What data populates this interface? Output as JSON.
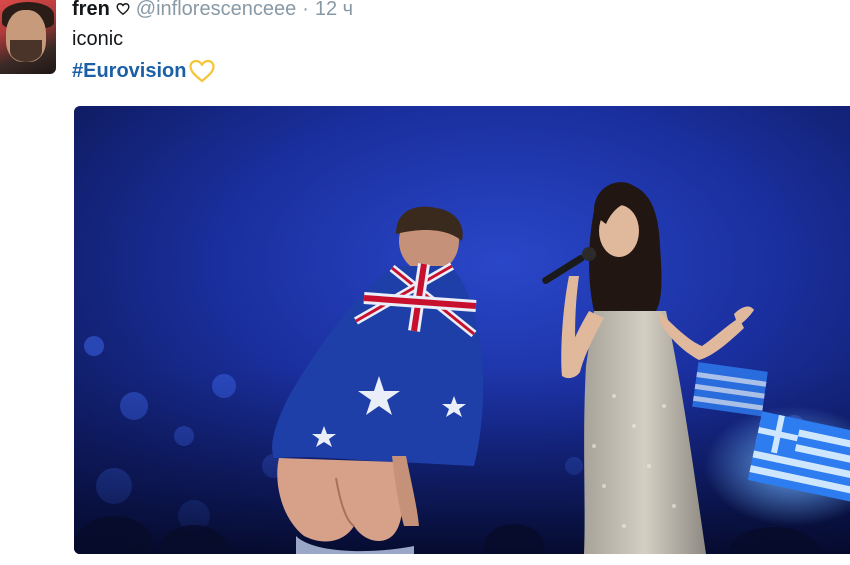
{
  "tweet": {
    "display_name": "fren",
    "handle": "@inflorescenceee",
    "separator": "·",
    "time": "12 ч",
    "text": "iconic",
    "hashtag": "#Eurovision",
    "name_icon": "heart-outline-icon",
    "hashtag_emoji": "yellow-heart-icon"
  },
  "colors": {
    "name": "#14171a",
    "muted": "#8899a6",
    "hashtag": "#1b5fa6",
    "heart": "#f5c437",
    "stage": "#1a2f9e"
  }
}
